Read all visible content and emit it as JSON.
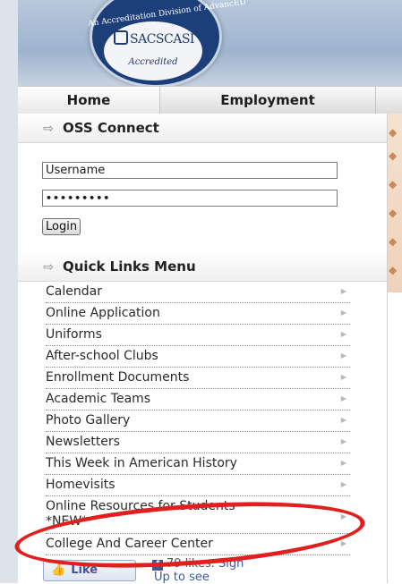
{
  "header": {
    "seal_arc_text": "An Accreditation Division of AdvancED",
    "seal_logo_text": "SACSCASI",
    "seal_status": "Accredited"
  },
  "nav": {
    "items": [
      {
        "label": "Home"
      },
      {
        "label": "Employment"
      }
    ]
  },
  "oss_connect": {
    "title": "OSS Connect",
    "username_value": "Username",
    "password_value": "•••••••••",
    "login_label": "Login"
  },
  "quick_links": {
    "title": "Quick Links Menu",
    "items": [
      {
        "label": "Calendar"
      },
      {
        "label": "Online Application"
      },
      {
        "label": "Uniforms"
      },
      {
        "label": "After-school Clubs"
      },
      {
        "label": "Enrollment Documents"
      },
      {
        "label": "Academic Teams"
      },
      {
        "label": "Photo Gallery"
      },
      {
        "label": "Newsletters"
      },
      {
        "label": "This Week in American History"
      },
      {
        "label": "Homevisits"
      },
      {
        "label": "Online Resources for Students",
        "sub": "*NEW*"
      },
      {
        "label": "College And Career Center"
      }
    ]
  },
  "facebook": {
    "like_label": "Like",
    "likes_text": "79 likes.",
    "signup_text": "Sign",
    "signup_rest": "Up to see"
  },
  "colors": {
    "annotation_circle": "#e0201e",
    "fb_blue": "#3b5998"
  }
}
